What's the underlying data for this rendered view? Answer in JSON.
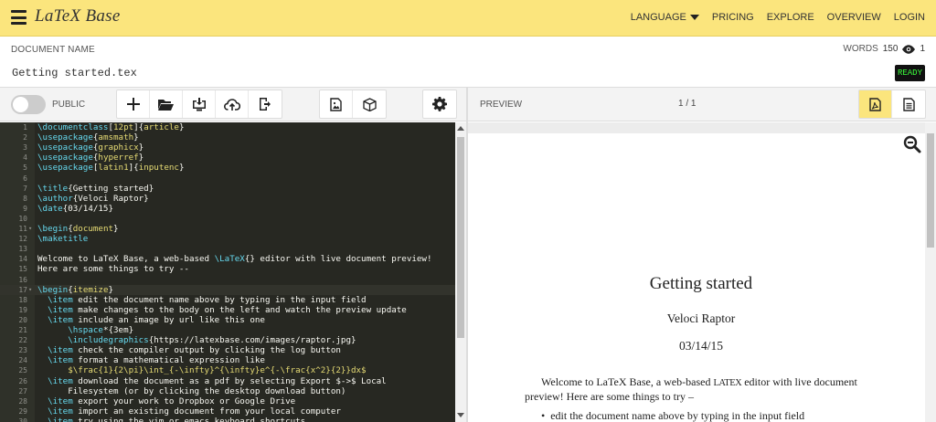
{
  "app": {
    "brand": "LaTeX Base",
    "nav": {
      "language": "LANGUAGE",
      "pricing": "PRICING",
      "explore": "EXPLORE",
      "overview": "OVERVIEW",
      "login": "LOGIN"
    }
  },
  "document": {
    "label": "DOCUMENT NAME",
    "name": "Getting started.tex",
    "words_label": "WORDS",
    "words_count": "150",
    "views_count": "1",
    "status": "READY"
  },
  "toolbar": {
    "public_label": "PUBLIC",
    "public_enabled": false,
    "preview_label": "PREVIEW",
    "page_indicator": "1 / 1"
  },
  "editor": {
    "lines": [
      {
        "n": "1",
        "fold": false,
        "parts": [
          [
            "kw",
            "\\documentclass"
          ],
          [
            "t",
            "["
          ],
          [
            "arg",
            "12pt"
          ],
          [
            "t",
            "]{"
          ],
          [
            "arg",
            "article"
          ],
          [
            "t",
            "}"
          ]
        ]
      },
      {
        "n": "2",
        "fold": false,
        "parts": [
          [
            "kw",
            "\\usepackage"
          ],
          [
            "t",
            "{"
          ],
          [
            "arg",
            "amsmath"
          ],
          [
            "t",
            "}"
          ]
        ]
      },
      {
        "n": "3",
        "fold": false,
        "parts": [
          [
            "kw",
            "\\usepackage"
          ],
          [
            "t",
            "{"
          ],
          [
            "arg",
            "graphicx"
          ],
          [
            "t",
            "}"
          ]
        ]
      },
      {
        "n": "4",
        "fold": false,
        "parts": [
          [
            "kw",
            "\\usepackage"
          ],
          [
            "t",
            "{"
          ],
          [
            "arg",
            "hyperref"
          ],
          [
            "t",
            "}"
          ]
        ]
      },
      {
        "n": "5",
        "fold": false,
        "parts": [
          [
            "kw",
            "\\usepackage"
          ],
          [
            "t",
            "["
          ],
          [
            "arg",
            "latin1"
          ],
          [
            "t",
            "]{"
          ],
          [
            "arg",
            "inputenc"
          ],
          [
            "t",
            "}"
          ]
        ]
      },
      {
        "n": "6",
        "fold": false,
        "parts": []
      },
      {
        "n": "7",
        "fold": false,
        "parts": [
          [
            "kw",
            "\\title"
          ],
          [
            "t",
            "{Getting started}"
          ]
        ]
      },
      {
        "n": "8",
        "fold": false,
        "parts": [
          [
            "kw",
            "\\author"
          ],
          [
            "t",
            "{Veloci Raptor}"
          ]
        ]
      },
      {
        "n": "9",
        "fold": false,
        "parts": [
          [
            "kw",
            "\\date"
          ],
          [
            "t",
            "{03/14/15}"
          ]
        ]
      },
      {
        "n": "10",
        "fold": false,
        "parts": []
      },
      {
        "n": "11",
        "fold": true,
        "parts": [
          [
            "kw",
            "\\begin"
          ],
          [
            "t",
            "{"
          ],
          [
            "arg",
            "document"
          ],
          [
            "t",
            "}"
          ]
        ]
      },
      {
        "n": "12",
        "fold": false,
        "parts": [
          [
            "kw",
            "\\maketitle"
          ]
        ]
      },
      {
        "n": "13",
        "fold": false,
        "parts": []
      },
      {
        "n": "14",
        "fold": false,
        "parts": [
          [
            "t",
            "Welcome to LaTeX Base, a web-based "
          ],
          [
            "kw",
            "\\LaTeX"
          ],
          [
            "t",
            "{} editor with live document preview!"
          ]
        ]
      },
      {
        "n": "15",
        "fold": false,
        "parts": [
          [
            "t",
            "Here are some things to try --"
          ]
        ]
      },
      {
        "n": "16",
        "fold": false,
        "parts": []
      },
      {
        "n": "17",
        "fold": true,
        "active": true,
        "parts": [
          [
            "kw",
            "\\begin"
          ],
          [
            "t",
            "{"
          ],
          [
            "arg",
            "itemize"
          ],
          [
            "t",
            "}"
          ]
        ]
      },
      {
        "n": "18",
        "fold": false,
        "parts": [
          [
            "t",
            "  "
          ],
          [
            "kw",
            "\\item"
          ],
          [
            "t",
            " edit the document name above by typing in the input field"
          ]
        ]
      },
      {
        "n": "19",
        "fold": false,
        "parts": [
          [
            "t",
            "  "
          ],
          [
            "kw",
            "\\item"
          ],
          [
            "t",
            " make changes to the body on the left and watch the preview update"
          ]
        ]
      },
      {
        "n": "20",
        "fold": false,
        "parts": [
          [
            "t",
            "  "
          ],
          [
            "kw",
            "\\item"
          ],
          [
            "t",
            " include an image by url like this one"
          ]
        ]
      },
      {
        "n": "21",
        "fold": false,
        "parts": [
          [
            "t",
            "      "
          ],
          [
            "kw",
            "\\hspace"
          ],
          [
            "t",
            "*{3em}"
          ]
        ]
      },
      {
        "n": "22",
        "fold": false,
        "parts": [
          [
            "t",
            "      "
          ],
          [
            "kw",
            "\\includegraphics"
          ],
          [
            "t",
            "{https://latexbase.com/images/raptor.jpg}"
          ]
        ]
      },
      {
        "n": "23",
        "fold": false,
        "parts": [
          [
            "t",
            "  "
          ],
          [
            "kw",
            "\\item"
          ],
          [
            "t",
            " check the compiler output by clicking the log button"
          ]
        ]
      },
      {
        "n": "24",
        "fold": false,
        "parts": [
          [
            "t",
            "  "
          ],
          [
            "kw",
            "\\item"
          ],
          [
            "t",
            " format a mathematical expression like"
          ]
        ]
      },
      {
        "n": "25",
        "fold": false,
        "parts": [
          [
            "arg",
            "      $\\frac{1}{2\\pi}\\int_{-\\infty}^{\\infty}e^{-\\frac{x^2}{2}}dx$"
          ]
        ]
      },
      {
        "n": "26",
        "fold": false,
        "parts": [
          [
            "t",
            "  "
          ],
          [
            "kw",
            "\\item"
          ],
          [
            "t",
            " download the document as a pdf by selecting Export $->$ Local"
          ]
        ]
      },
      {
        "n": "27",
        "fold": false,
        "parts": [
          [
            "t",
            "      Filesystem (or by clicking the desktop download button)"
          ]
        ]
      },
      {
        "n": "28",
        "fold": false,
        "parts": [
          [
            "t",
            "  "
          ],
          [
            "kw",
            "\\item"
          ],
          [
            "t",
            " export your work to Dropbox or Google Drive"
          ]
        ]
      },
      {
        "n": "29",
        "fold": false,
        "parts": [
          [
            "t",
            "  "
          ],
          [
            "kw",
            "\\item"
          ],
          [
            "t",
            " import an existing document from your local computer"
          ]
        ]
      },
      {
        "n": "30",
        "fold": false,
        "parts": [
          [
            "t",
            "  "
          ],
          [
            "kw",
            "\\item"
          ],
          [
            "t",
            " try using the vim or emacs keyboard shortcuts"
          ]
        ]
      }
    ]
  },
  "preview": {
    "title": "Getting started",
    "author": "Veloci Raptor",
    "date": "03/14/15",
    "body_before": "Welcome to LaTeX Base, a web-based ",
    "body_latex": "LATEX",
    "body_after": " editor with live document preview! Here are some things to try –",
    "bullet1": "edit the document name above by typing in the input field"
  },
  "colors": {
    "accent": "#fbe57d",
    "editor_bg": "#272822",
    "keyword": "#66d9ef",
    "argument": "#e6db74",
    "ready_text": "#3cff3c"
  },
  "icons": {
    "toolbar": [
      "plus-icon",
      "folder-open-icon",
      "desktop-download-icon",
      "cloud-upload-icon",
      "export-icon",
      "image-icon",
      "package-icon",
      "gear-icon"
    ],
    "preview_modes": [
      "pdf-icon",
      "log-icon"
    ]
  }
}
